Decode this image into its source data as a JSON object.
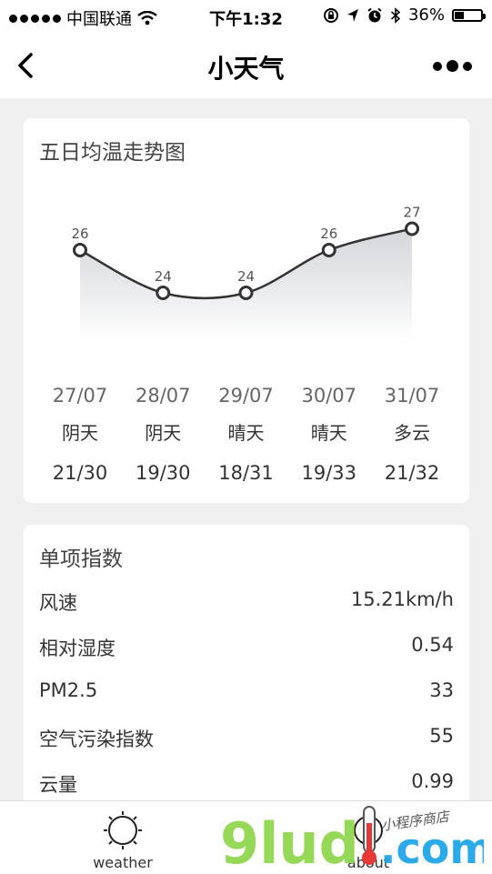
{
  "status_bar": {
    "carrier": "中国联通",
    "time": "下午1:32",
    "battery": "36%",
    "battery_level": 0.36
  },
  "nav": {
    "title": "小天气",
    "icons": [
      "back-chevron-icon",
      "more-icon"
    ]
  },
  "trend_card": {
    "title": "五日均温走势图",
    "days": [
      {
        "date": "27/07",
        "weather": "阴天",
        "range": "21/30"
      },
      {
        "date": "28/07",
        "weather": "阴天",
        "range": "19/30"
      },
      {
        "date": "29/07",
        "weather": "晴天",
        "range": "18/31"
      },
      {
        "date": "30/07",
        "weather": "晴天",
        "range": "19/33"
      },
      {
        "date": "31/07",
        "weather": "多云",
        "range": "21/32"
      }
    ]
  },
  "chart_data": {
    "type": "line",
    "categories": [
      "27/07",
      "28/07",
      "29/07",
      "30/07",
      "31/07"
    ],
    "values": [
      26,
      24,
      24,
      26,
      27
    ],
    "title": "五日均温走势图",
    "xlabel": "",
    "ylabel": "",
    "grid": false,
    "area_fill": true,
    "line_color": "#333333"
  },
  "index_card": {
    "title": "单项指数",
    "items": [
      {
        "label": "风速",
        "value": "15.21km/h"
      },
      {
        "label": "相对湿度",
        "value": "0.54"
      },
      {
        "label": "PM2.5",
        "value": "33"
      },
      {
        "label": "空气污染指数",
        "value": "55"
      },
      {
        "label": "云量",
        "value": "0.99"
      }
    ]
  },
  "tabbar": {
    "tabs": [
      {
        "label": "weather",
        "icon": "sun-icon"
      },
      {
        "label": "about",
        "icon": "info-icon"
      }
    ]
  },
  "watermark": {
    "text": "9lud.com",
    "subtext": "小程序商店"
  },
  "colors": {
    "background": "#f0f0f0",
    "card": "#ffffff",
    "watermark_green": "#8ed64a",
    "watermark_blue": "#1aa3e8"
  }
}
